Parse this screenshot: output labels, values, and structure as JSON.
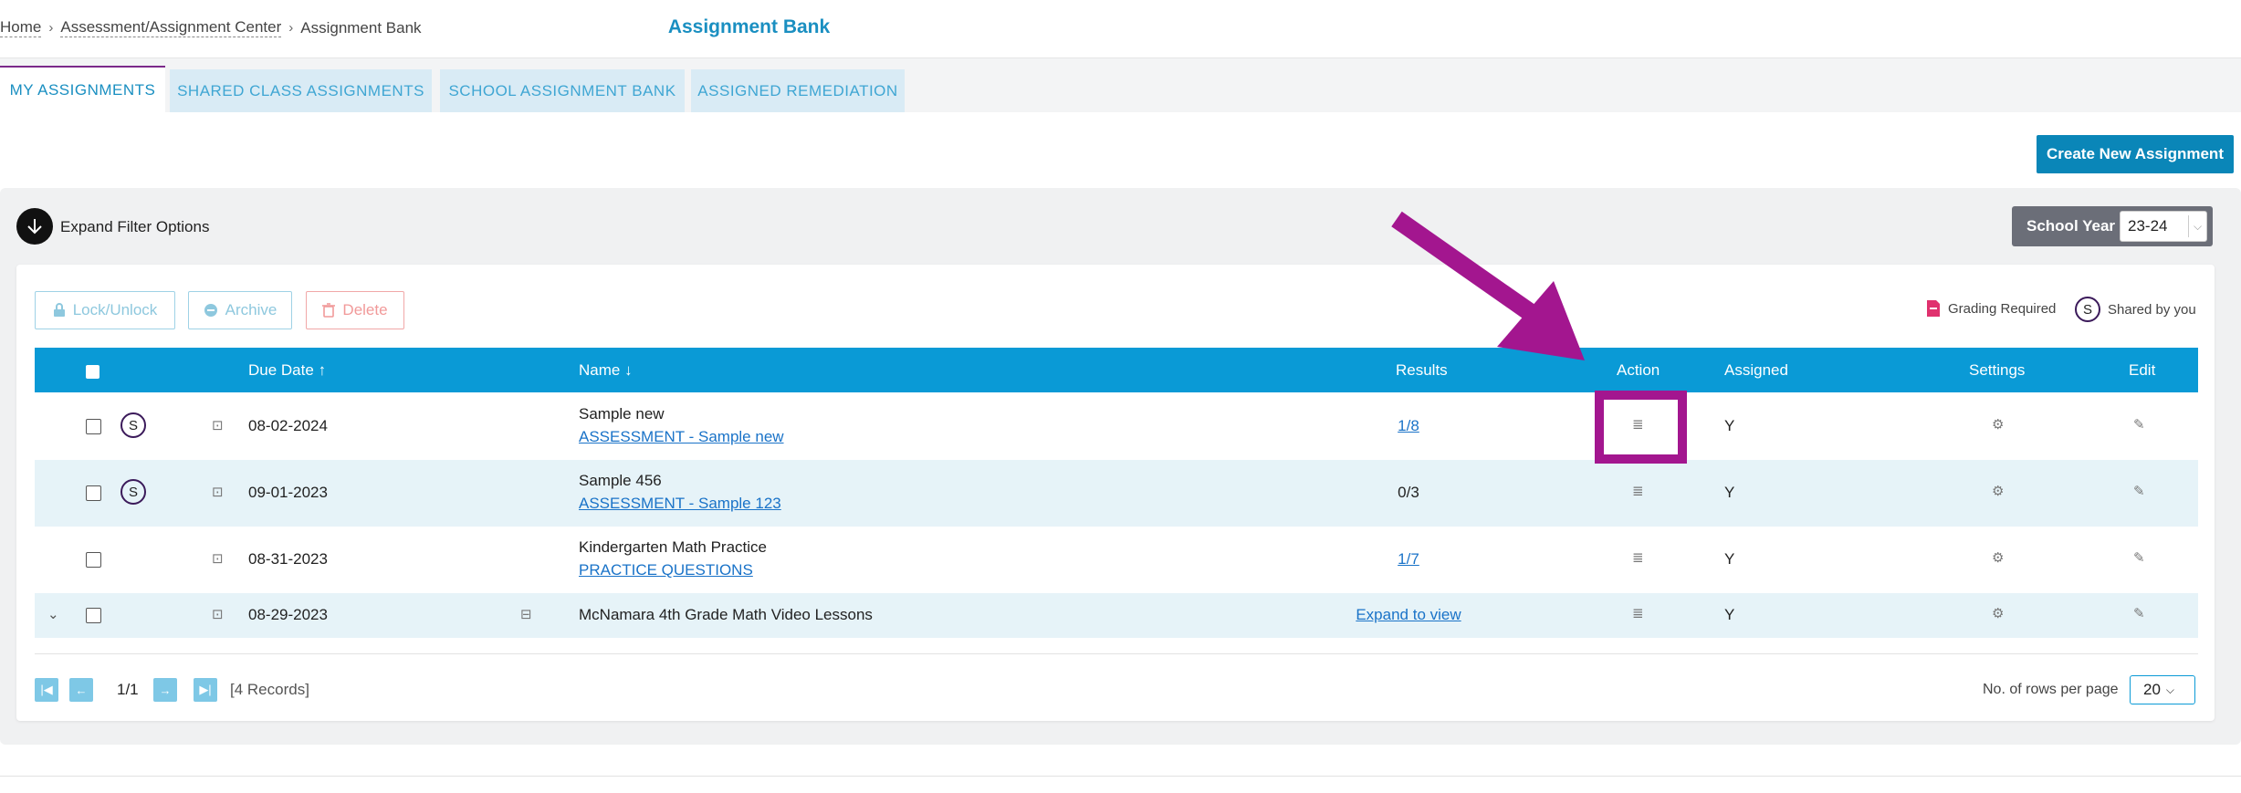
{
  "breadcrumb": {
    "home": "Home",
    "center": "Assessment/Assignment Center",
    "current": "Assignment Bank"
  },
  "page_title": "Assignment Bank",
  "tabs": [
    {
      "label": "MY ASSIGNMENTS"
    },
    {
      "label": "SHARED CLASS ASSIGNMENTS"
    },
    {
      "label": "SCHOOL ASSIGNMENT BANK"
    },
    {
      "label": "ASSIGNED REMEDIATION"
    }
  ],
  "create_button": "Create New Assignment",
  "filter": {
    "expand_label": "Expand Filter Options",
    "school_year_label": "School Year",
    "school_year_value": "23-24"
  },
  "actions": {
    "lock": "Lock/Unlock",
    "archive": "Archive",
    "delete": "Delete"
  },
  "legend": {
    "grading_required": "Grading Required",
    "shared_by_you": "Shared by you",
    "shared_badge": "S"
  },
  "table": {
    "headers": {
      "due_date": "Due Date",
      "name": "Name",
      "results": "Results",
      "action": "Action",
      "assigned": "Assigned",
      "settings": "Settings",
      "edit": "Edit"
    },
    "rows": [
      {
        "due_date": "08-02-2024",
        "name": "Sample new",
        "sub_link": "ASSESSMENT - Sample new",
        "results": "1/8",
        "assigned": "Y",
        "shared": "S"
      },
      {
        "due_date": "09-01-2023",
        "name": "Sample 456",
        "sub_link": "ASSESSMENT - Sample 123",
        "results": "0/3",
        "assigned": "Y",
        "shared": "S"
      },
      {
        "due_date": "08-31-2023",
        "name": "Kindergarten Math Practice",
        "sub_link": "PRACTICE QUESTIONS",
        "results": "1/7",
        "assigned": "Y"
      },
      {
        "due_date": "08-29-2023",
        "name": "McNamara 4th Grade Math Video Lessons",
        "results": "Expand to view",
        "assigned": "Y"
      }
    ]
  },
  "pagination": {
    "page": "1/1",
    "records": "[4 Records]",
    "rows_label": "No. of rows per page",
    "rows_value": "20"
  },
  "colors": {
    "accent": "#0a9ad6",
    "annotation": "#a3168f"
  }
}
